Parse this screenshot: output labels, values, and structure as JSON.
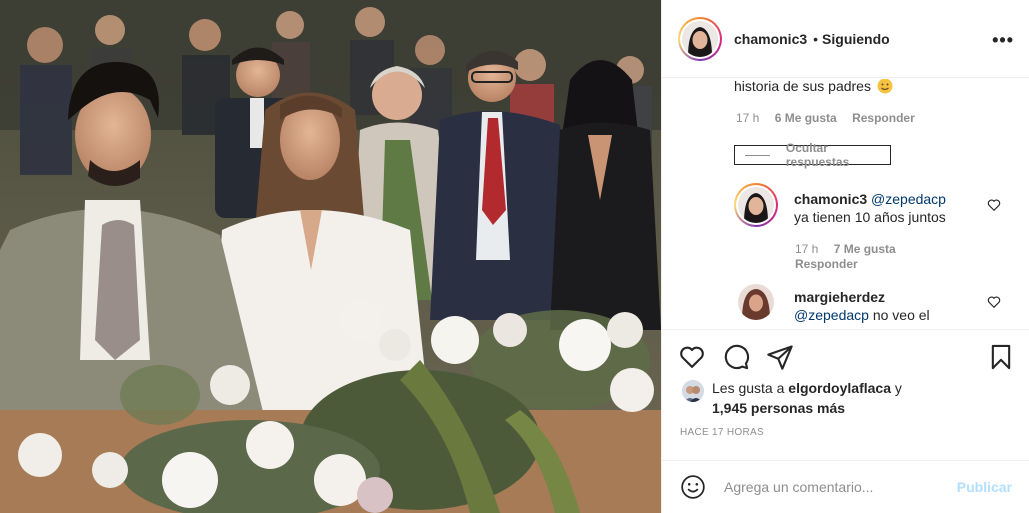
{
  "header": {
    "username": "chamonic3",
    "separator": "•",
    "follow_status": "Siguiendo",
    "more_icon": "more-horizontal-icon"
  },
  "comments": {
    "caption_tail": "historia de sus padres",
    "caption_emoji": "smiling-face-emoji",
    "caption_meta": {
      "time": "17 h",
      "likes": "6 Me gusta",
      "reply": "Responder"
    },
    "hide_replies": "Ocultar respuestas",
    "replies": [
      {
        "username": "chamonic3",
        "mention": "@zepedacp",
        "text": "ya tienen 10 años juntos",
        "time": "17 h",
        "likes": "7 Me gusta",
        "reply": "Responder"
      },
      {
        "username": "margieherdez",
        "mention": "@zepedacp",
        "text": "no veo el"
      }
    ]
  },
  "actions": {
    "likes_prefix": "Les gusta a",
    "likes_user": "elgordoylaflaca",
    "likes_connector": "y",
    "likes_count": "1,945 personas más",
    "timestamp": "HACE 17 HORAS",
    "comment_placeholder": "Agrega un comentario...",
    "publish_label": "Publicar"
  },
  "colors": {
    "link": "#00376b",
    "muted": "#8e8e8e",
    "publish_disabled": "#b2dffc",
    "border": "#efefef"
  }
}
